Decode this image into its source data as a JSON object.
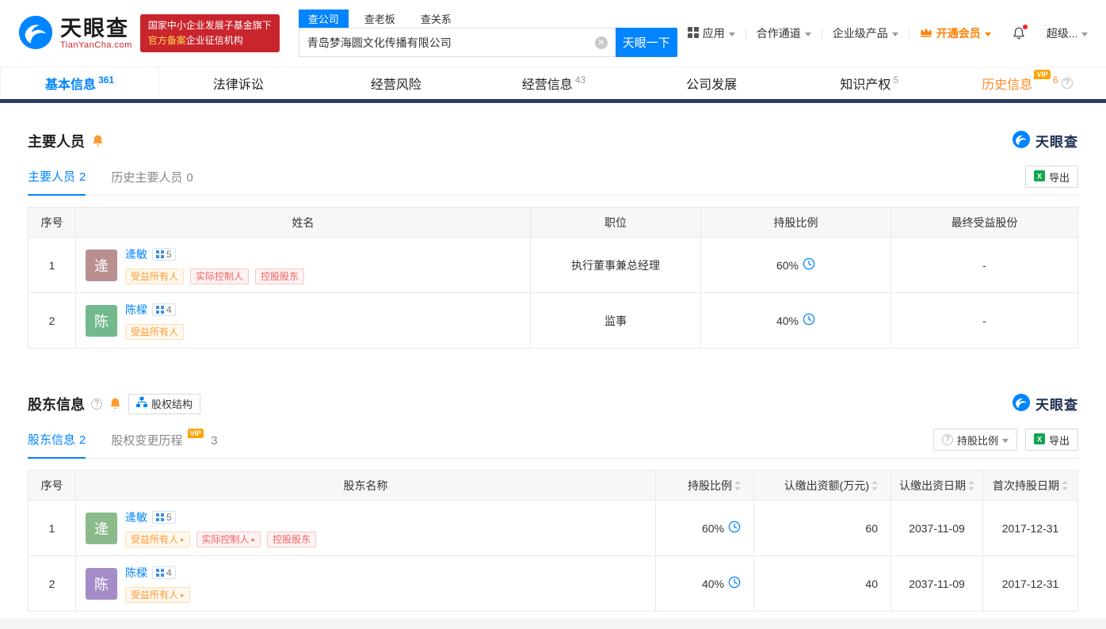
{
  "brand": {
    "name_cn": "天眼查",
    "name_en": "TianYanCha.com",
    "accent_blue": "#0084ff",
    "navy_bar": "#2b3e68"
  },
  "header": {
    "gov_badge": {
      "line1": "国家中小企业发展子基金旗下",
      "line2_highlight": "官方备案",
      "line2_rest": "企业征信机构"
    },
    "search": {
      "tabs": [
        {
          "label": "查公司"
        },
        {
          "label": "查老板"
        },
        {
          "label": "查关系"
        }
      ],
      "value": "青岛梦海圆文化传播有限公司",
      "button_label": "天眼一下"
    },
    "nav": {
      "apps": "应用",
      "cooperation": "合作通道",
      "enterprise": "企业级产品",
      "vip": "开通会员",
      "super": "超级..."
    }
  },
  "tabbar": [
    {
      "label": "基本信息",
      "count": "361"
    },
    {
      "label": "法律诉讼"
    },
    {
      "label": "经营风险"
    },
    {
      "label": "经营信息",
      "count": "43"
    },
    {
      "label": "公司发展"
    },
    {
      "label": "知识产权",
      "count": "5"
    },
    {
      "label": "历史信息",
      "count": "6",
      "vip": "VIP"
    }
  ],
  "staff": {
    "title": "主要人员",
    "tabs": {
      "current": {
        "label": "主要人员",
        "count": "2"
      },
      "history": {
        "label": "历史主要人员",
        "count": "0"
      }
    },
    "export_label": "导出",
    "headers": {
      "no": "序号",
      "name": "姓名",
      "position": "职位",
      "ratio": "持股比例",
      "benefit": "最终受益股份"
    },
    "rows": [
      {
        "no": "1",
        "avatar": {
          "char": "逄",
          "color": "#b98f8f"
        },
        "name": "逄敏",
        "badge": "5",
        "tags": [
          "受益所有人",
          "实际控制人",
          "控股股东"
        ],
        "position": "执行董事兼总经理",
        "ratio": "60%",
        "benefit": "-"
      },
      {
        "no": "2",
        "avatar": {
          "char": "陈",
          "color": "#72b98c"
        },
        "name": "陈樑",
        "badge": "4",
        "tags": [
          "受益所有人"
        ],
        "position": "监事",
        "ratio": "40%",
        "benefit": "-"
      }
    ]
  },
  "shareholders": {
    "title": "股东信息",
    "structure_button": "股权结构",
    "tabs": {
      "current": {
        "label": "股东信息",
        "count": "2"
      },
      "history": {
        "label": "股权变更历程",
        "count": "3",
        "vip": "VIP"
      }
    },
    "filter_button": "持股比例",
    "export_label": "导出",
    "headers": {
      "no": "序号",
      "name": "股东名称",
      "ratio": "持股比例",
      "amount": "认缴出资额(万元)",
      "date": "认缴出资日期",
      "first_date": "首次持股日期"
    },
    "rows": [
      {
        "no": "1",
        "avatar": {
          "char": "逄",
          "color": "#8bbb8b"
        },
        "name": "逄敏",
        "badge": "5",
        "tags": [
          "受益所有人",
          "实际控制人",
          "控股股东"
        ],
        "ratio": "60%",
        "amount": "60",
        "date": "2037-11-09",
        "first_date": "2017-12-31"
      },
      {
        "no": "2",
        "avatar": {
          "char": "陈",
          "color": "#a58cc8"
        },
        "name": "陈樑",
        "badge": "4",
        "tags": [
          "受益所有人"
        ],
        "ratio": "40%",
        "amount": "40",
        "date": "2037-11-09",
        "first_date": "2017-12-31"
      }
    ]
  }
}
